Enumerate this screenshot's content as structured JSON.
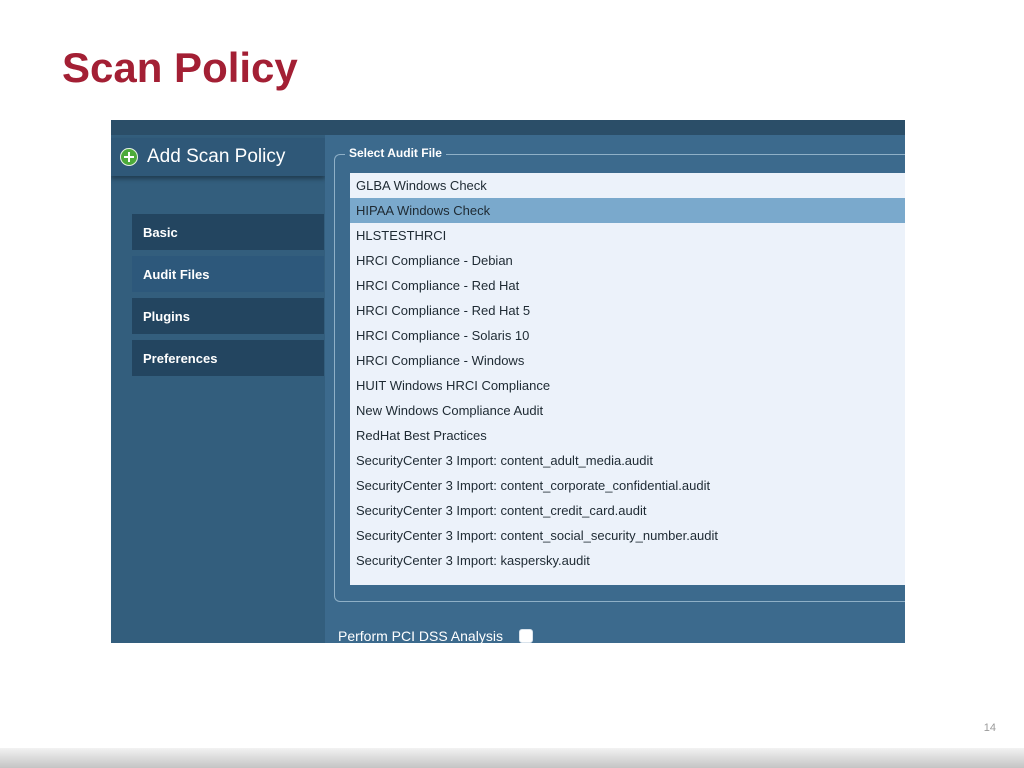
{
  "slide": {
    "title": "Scan Policy",
    "page_number": "14"
  },
  "app": {
    "header": {
      "icon": "add-circle-icon",
      "label": "Add Scan Policy"
    },
    "nav": [
      {
        "label": "Basic",
        "active": false
      },
      {
        "label": "Audit Files",
        "active": true
      },
      {
        "label": "Plugins",
        "active": false
      },
      {
        "label": "Preferences",
        "active": false
      }
    ],
    "audit_file": {
      "legend": "Select Audit File",
      "selected": "HIPAA Windows Check",
      "options": [
        "GLBA Windows Check",
        "HIPAA Windows Check",
        "HLSTESTHRCI",
        "HRCI Compliance - Debian",
        "HRCI Compliance - Red Hat",
        "HRCI Compliance - Red Hat 5",
        "HRCI Compliance - Solaris 10",
        "HRCI Compliance - Windows",
        "HUIT Windows HRCI Compliance",
        "New Windows Compliance Audit",
        "RedHat Best Practices",
        "SecurityCenter 3 Import: content_adult_media.audit",
        "SecurityCenter 3 Import: content_corporate_confidential.audit",
        "SecurityCenter 3 Import: content_credit_card.audit",
        "SecurityCenter 3 Import: content_social_security_number.audit",
        "SecurityCenter 3 Import: kaspersky.audit"
      ]
    },
    "pci": {
      "label": "Perform PCI DSS Analysis",
      "checked": false
    }
  },
  "colors": {
    "title": "#a31f34",
    "panel": "#3c6a8d",
    "selected_row": "#7aa9cc"
  }
}
